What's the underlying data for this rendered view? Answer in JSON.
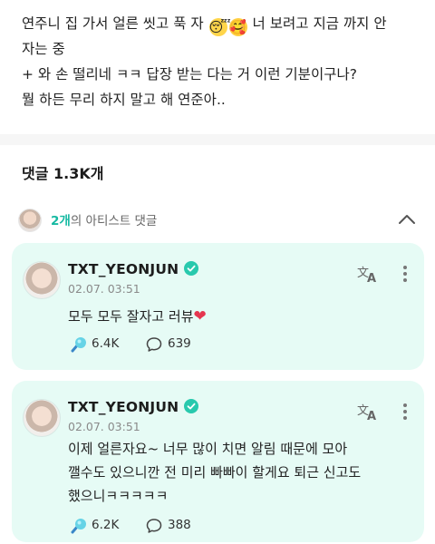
{
  "post": {
    "line1_a": "연주니 집 가서 얼른 씻고 푹 자 ",
    "line1_b": " 너 보려고 지금 까지 안",
    "line2": "자는 중",
    "line3": "+ 와 손 떨리네 ㅋㅋ 답장 받는 다는 거 이런 기분이구나?",
    "line4": "뭘 하든 무리 하지 말고 해 연준아..",
    "emoji_sleep": "😴",
    "emoji_hearts": "🥰"
  },
  "comments": {
    "title": "댓글 1.3K개",
    "artist_count": "2개",
    "artist_label": "의 아티스트 댓글"
  },
  "cards": [
    {
      "name": "TXT_YEONJUN",
      "date": "02.07. 03:51",
      "text_line1": "모두 모두 잘자고 러뷰",
      "heart": "❤",
      "likes": "6.4K",
      "replies": "639"
    },
    {
      "name": "TXT_YEONJUN",
      "date": "02.07. 03:51",
      "text_line1": "이제 얼른자요~ 너무 많이 치면 알림 때문에 모아",
      "text_line2": "깰수도 있으니깐 전 미리 빠빠이 할게요 퇴근 신고도",
      "text_line3": "했으니ㅋㅋㅋㅋㅋ",
      "likes": "6.2K",
      "replies": "388"
    }
  ],
  "colors": {
    "accent": "#16b9a2",
    "card_bg": "#e6fbf5",
    "verified": "#28c9ad",
    "heart": "#e5364f"
  },
  "icons": [
    "verified-badge-icon",
    "translate-icon",
    "more-icon",
    "lightstick-icon",
    "comment-bubble-icon",
    "chevron-up-icon"
  ]
}
